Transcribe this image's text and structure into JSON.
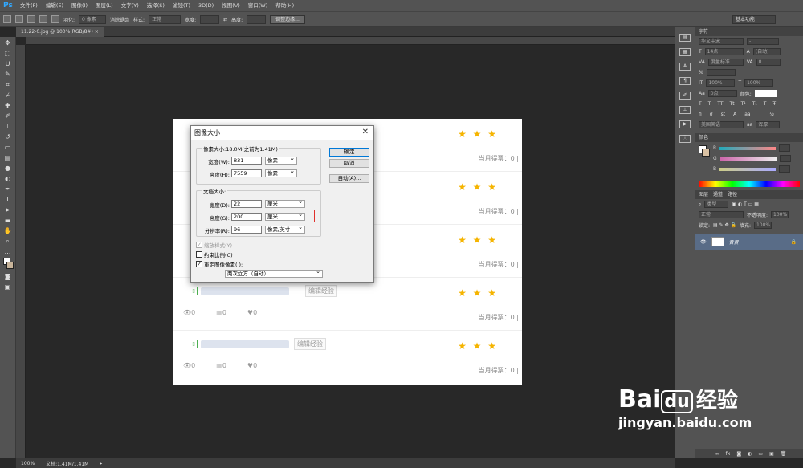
{
  "menubar": {
    "logo": "Ps",
    "items": [
      "文件(F)",
      "编辑(E)",
      "图像(I)",
      "图层(L)",
      "文字(Y)",
      "选择(S)",
      "滤镜(T)",
      "3D(D)",
      "视图(V)",
      "窗口(W)",
      "帮助(H)"
    ]
  },
  "options": {
    "feather_label": "羽化:",
    "feather_value": "0 像素",
    "antialias": "消除锯齿",
    "style_label": "样式:",
    "style_value": "正常",
    "width_label": "宽度:",
    "height_label": "高度:",
    "refine_button": "调整边缘...",
    "workspace": "基本功能"
  },
  "doc_tab": {
    "title": "11.22-0.jpg @ 100%(RGB/8#)",
    "close": "×"
  },
  "status": {
    "zoom": "100%",
    "doc_info": "文档:1.41M/1.41M"
  },
  "canvas_rows": [
    {
      "tally": "当月得票：0 |"
    },
    {
      "tally": "当月得票：0 |"
    },
    {
      "tally": "当月得票：0 |"
    },
    {
      "edit": "编辑经验",
      "tally": "当月得票：0 |",
      "counts": [
        "0",
        "0",
        "0"
      ]
    },
    {
      "edit": "编辑经验",
      "tally": "当月得票：0 |",
      "counts": [
        "0",
        "0",
        "0"
      ]
    }
  ],
  "stars": "★ ★ ★",
  "dialog": {
    "title": "图像大小",
    "pixel_group": "像素大小:18.0M(之前为1.41M)",
    "px_width_label": "宽度(W):",
    "px_width": "831",
    "px_width_unit": "像素",
    "px_height_label": "高度(H):",
    "px_height": "7559",
    "px_height_unit": "像素",
    "doc_group": "文档大小:",
    "doc_width_label": "宽度(D):",
    "doc_width": "22",
    "doc_width_unit": "厘米",
    "doc_height_label": "高度(G):",
    "doc_height": "200",
    "doc_height_unit": "厘米",
    "res_label": "分辨率(R):",
    "res": "96",
    "res_unit": "像素/英寸",
    "scale_styles": "缩放样式(Y)",
    "constrain": "约束比例(C)",
    "resample": "重定图像像素(I):",
    "resample_method": "两次立方（自动）",
    "ok": "确定",
    "cancel": "取消",
    "auto": "自动(A)..."
  },
  "right_panel": {
    "char_tab": "字符",
    "font": "华文中宋",
    "font_style": "-",
    "size": "14点",
    "leading": "(自动)",
    "kerning": "度量标准",
    "tracking": "0",
    "scale_v": "100%",
    "scale_h": "100%",
    "baseline": "0点",
    "color_label": "颜色:",
    "lang": "美国英语",
    "aa": "浑厚",
    "color_tab": "颜色",
    "r": "R",
    "g": "G",
    "b": "B",
    "layers_tabs": [
      "图层",
      "通道",
      "路径"
    ],
    "kind": "类型",
    "blend": "正常",
    "opacity_label": "不透明度:",
    "opacity": "100%",
    "lock_label": "锁定:",
    "fill_label": "填充:",
    "fill": "100%",
    "layer_name": "背景"
  },
  "watermark": {
    "brand": "Bai",
    "brand2": "经验",
    "url": "jingyan.baidu.com"
  }
}
